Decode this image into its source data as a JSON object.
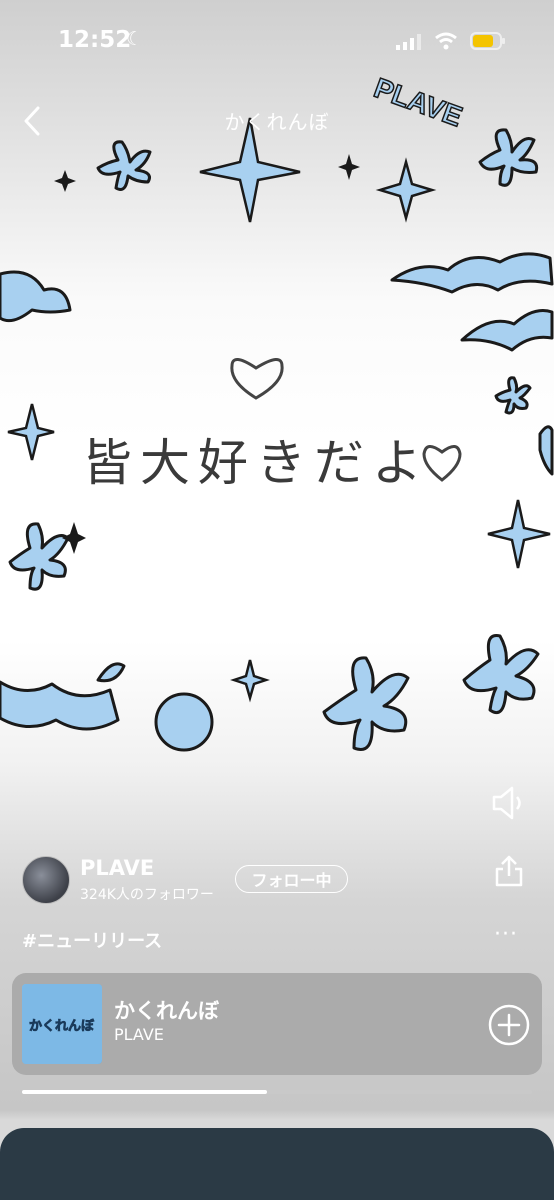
{
  "status_bar": {
    "time": "12:52"
  },
  "header": {
    "title": "かくれんぼ"
  },
  "artwork": {
    "logo_text": "PLAVE",
    "message": "皆大好きだよ"
  },
  "artist": {
    "name": "PLAVE",
    "followers": "324K人のフォロワー",
    "follow_label": "フォロー中"
  },
  "post": {
    "hashtag": "#ニューリリース",
    "more_label": "···"
  },
  "track": {
    "title": "かくれんぼ",
    "artist": "PLAVE",
    "thumb_text": "かくれんぼ"
  },
  "playback": {
    "progress": 0.48
  },
  "colors": {
    "flower": "#a8d0f0",
    "ink": "#1a1a1a"
  }
}
